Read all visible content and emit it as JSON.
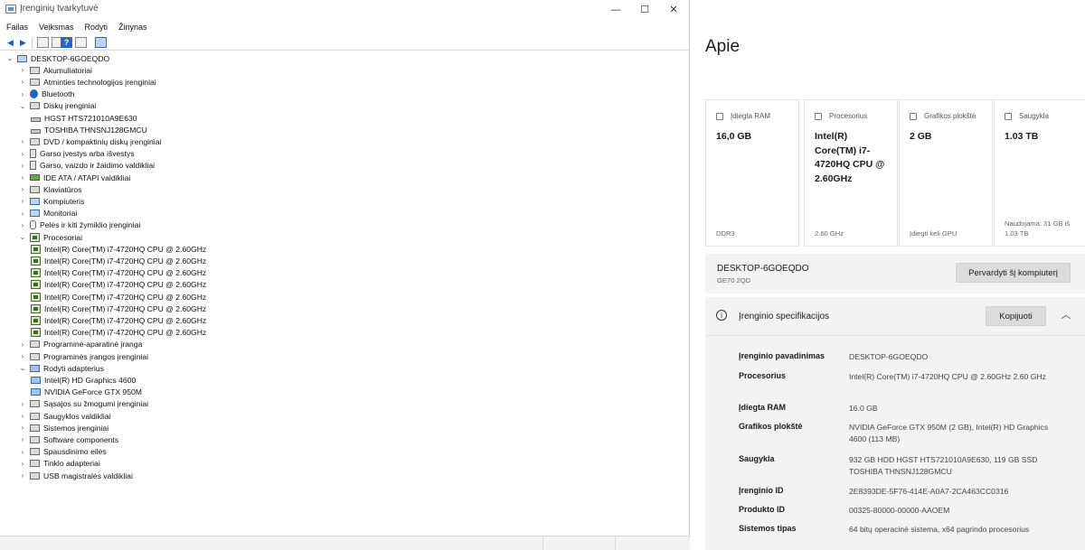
{
  "device_manager": {
    "title": "Įrenginių tvarkytuvė",
    "window_controls": {
      "minimize": "—",
      "maximize": "☐",
      "close": "✕"
    },
    "menu": [
      "Failas",
      "Veiksmas",
      "Rodyti",
      "Žinynas"
    ],
    "tree": [
      {
        "label": "DESKTOP-6GOEQDO",
        "level": 0,
        "expander": "expanded",
        "icon": "computer-icon"
      },
      {
        "label": "Akumuliatoriai",
        "level": 1,
        "expander": "collapsed",
        "icon": "battery-icon"
      },
      {
        "label": "Atminties technologijos įrenginiai",
        "level": 1,
        "expander": "collapsed",
        "icon": "memory-icon"
      },
      {
        "label": "Bluetooth",
        "level": 1,
        "expander": "collapsed",
        "icon": "bluetooth-icon"
      },
      {
        "label": "Diskų įrenginiai",
        "level": 1,
        "expander": "expanded",
        "icon": "disk-icon"
      },
      {
        "label": "HGST HTS721010A9E630",
        "level": 2,
        "expander": "none",
        "icon": "drive-icon"
      },
      {
        "label": "TOSHIBA THNSNJ128GMCU",
        "level": 2,
        "expander": "none",
        "icon": "drive-icon"
      },
      {
        "label": "DVD / kompaktinių diskų įrenginiai",
        "level": 1,
        "expander": "collapsed",
        "icon": "dvd-icon"
      },
      {
        "label": "Garso įvestys arba išvestys",
        "level": 1,
        "expander": "collapsed",
        "icon": "speaker-icon"
      },
      {
        "label": "Garso, vaizdo ir žaidimo valdikliai",
        "level": 1,
        "expander": "collapsed",
        "icon": "speaker-icon"
      },
      {
        "label": "IDE ATA / ATAPI valdikliai",
        "level": 1,
        "expander": "collapsed",
        "icon": "chip-icon"
      },
      {
        "label": "Klaviatūros",
        "level": 1,
        "expander": "collapsed",
        "icon": "keyboard-icon"
      },
      {
        "label": "Kompiuteris",
        "level": 1,
        "expander": "collapsed",
        "icon": "computer-icon"
      },
      {
        "label": "Monitoriai",
        "level": 1,
        "expander": "collapsed",
        "icon": "monitor-icon"
      },
      {
        "label": "Pelės ir kiti žymiklio įrenginiai",
        "level": 1,
        "expander": "collapsed",
        "icon": "mouse-icon"
      },
      {
        "label": "Procesoriai",
        "level": 1,
        "expander": "expanded",
        "icon": "processor-icon"
      },
      {
        "label": "Intel(R) Core(TM) i7-4720HQ CPU @ 2.60GHz",
        "level": 2,
        "expander": "none",
        "icon": "processor-icon"
      },
      {
        "label": "Intel(R) Core(TM) i7-4720HQ CPU @ 2.60GHz",
        "level": 2,
        "expander": "none",
        "icon": "processor-icon"
      },
      {
        "label": "Intel(R) Core(TM) i7-4720HQ CPU @ 2.60GHz",
        "level": 2,
        "expander": "none",
        "icon": "processor-icon"
      },
      {
        "label": "Intel(R) Core(TM) i7-4720HQ CPU @ 2.60GHz",
        "level": 2,
        "expander": "none",
        "icon": "processor-icon"
      },
      {
        "label": "Intel(R) Core(TM) i7-4720HQ CPU @ 2.60GHz",
        "level": 2,
        "expander": "none",
        "icon": "processor-icon"
      },
      {
        "label": "Intel(R) Core(TM) i7-4720HQ CPU @ 2.60GHz",
        "level": 2,
        "expander": "none",
        "icon": "processor-icon"
      },
      {
        "label": "Intel(R) Core(TM) i7-4720HQ CPU @ 2.60GHz",
        "level": 2,
        "expander": "none",
        "icon": "processor-icon"
      },
      {
        "label": "Intel(R) Core(TM) i7-4720HQ CPU @ 2.60GHz",
        "level": 2,
        "expander": "none",
        "icon": "processor-icon"
      },
      {
        "label": "Programinė-aparatinė įranga",
        "level": 1,
        "expander": "collapsed",
        "icon": "firmware-icon"
      },
      {
        "label": "Programinės įrangos įrenginiai",
        "level": 1,
        "expander": "collapsed",
        "icon": "device-icon"
      },
      {
        "label": "Rodyti adapterius",
        "level": 1,
        "expander": "expanded",
        "icon": "display-adapter-icon"
      },
      {
        "label": "Intel(R) HD Graphics 4600",
        "level": 2,
        "expander": "none",
        "icon": "display-adapter-icon"
      },
      {
        "label": "NVIDIA GeForce GTX 950M",
        "level": 2,
        "expander": "none",
        "icon": "display-adapter-icon"
      },
      {
        "label": "Sąsajos su žmogumi įrenginiai",
        "level": 1,
        "expander": "collapsed",
        "icon": "hid-icon"
      },
      {
        "label": "Saugyklos valdikliai",
        "level": 1,
        "expander": "collapsed",
        "icon": "storage-icon"
      },
      {
        "label": "Sistemos įrenginiai",
        "level": 1,
        "expander": "collapsed",
        "icon": "system-icon"
      },
      {
        "label": "Software components",
        "level": 1,
        "expander": "collapsed",
        "icon": "software-icon"
      },
      {
        "label": "Spausdinimo eilės",
        "level": 1,
        "expander": "collapsed",
        "icon": "printer-icon"
      },
      {
        "label": "Tinklo adapteriai",
        "level": 1,
        "expander": "collapsed",
        "icon": "network-icon"
      },
      {
        "label": "USB magistralės valdikliai",
        "level": 1,
        "expander": "collapsed",
        "icon": "usb-icon"
      }
    ]
  },
  "about": {
    "title": "Apie",
    "cards": [
      {
        "label": "Įdiegta RAM",
        "value": "16,0 GB",
        "sub": "DDR3",
        "icon": "ram-icon"
      },
      {
        "label": "Procesorius",
        "value": "Intel(R) Core(TM) i7-4720HQ CPU @ 2.60GHz",
        "sub": "2.60 GHz",
        "icon": "processor-icon"
      },
      {
        "label": "Grafikos plokštė",
        "value": "2 GB",
        "sub": "Įdiegti keli GPU",
        "icon": "gpu-icon"
      },
      {
        "label": "Saugykla",
        "value": "1.03 TB",
        "sub": "Naudojama: 31 GB iš 1.03 TB",
        "icon": "storage-icon"
      }
    ],
    "device": {
      "name": "DESKTOP-6GOEQDO",
      "model": "GE70 2QD",
      "rename_label": "Pervardyti šį kompiuterį"
    },
    "specs": {
      "title": "Įrenginio specifikacijos",
      "copy_label": "Kopijuoti",
      "rows": [
        {
          "key": "Įrenginio pavadinimas",
          "value": "DESKTOP-6GOEQDO"
        },
        {
          "key": "Procesorius",
          "value": "Intel(R) Core(TM) i7-4720HQ CPU @ 2.60GHz 2.60 GHz"
        },
        {
          "key": "Įdiegta RAM",
          "value": "16.0 GB"
        },
        {
          "key": "Grafikos plokštė",
          "value": "NVIDIA GeForce GTX 950M (2 GB), Intel(R) HD Graphics 4600 (113 MB)"
        },
        {
          "key": "Saugykla",
          "value": "932 GB HDD HGST HTS721010A9E630, 119 GB SSD TOSHIBA THNSNJ128GMCU"
        },
        {
          "key": "Įrenginio ID",
          "value": "2E8393DE-5F76-414E-A0A7-2CA463CC0316"
        },
        {
          "key": "Produkto ID",
          "value": "00325-80000-00000-AAOEM"
        },
        {
          "key": "Sistemos tipas",
          "value": "64 bitų operacinė sistema, x64 pagrindo procesorius"
        }
      ]
    }
  }
}
